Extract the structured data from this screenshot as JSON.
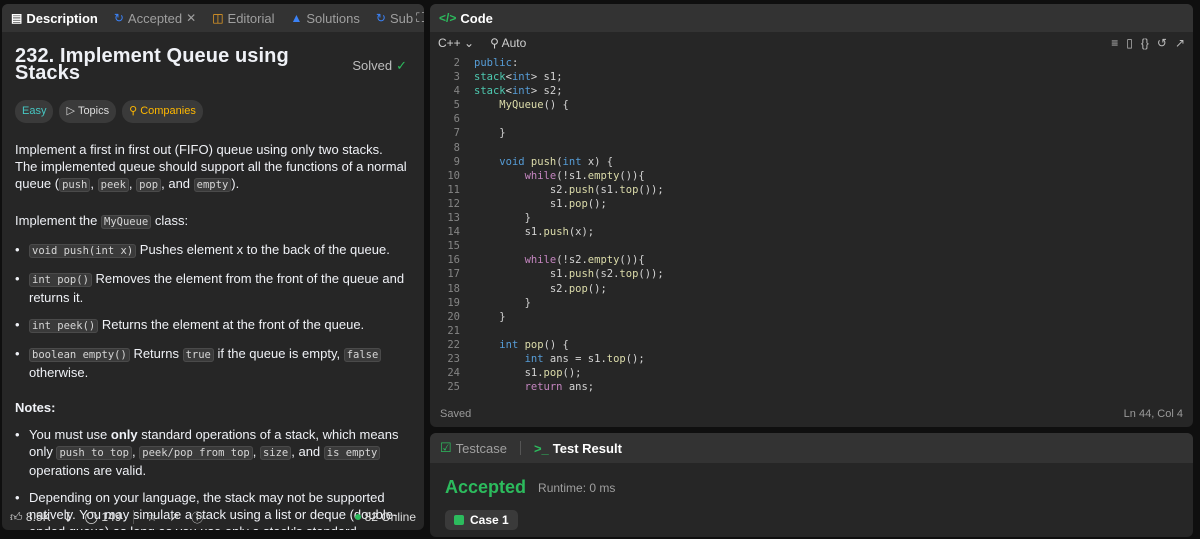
{
  "left_tabs": [
    {
      "label": "Description",
      "icon": "description-icon",
      "active": true
    },
    {
      "label": "Accepted",
      "icon": "history-icon",
      "active": false
    },
    {
      "label": "Editorial",
      "icon": "book-icon",
      "active": false
    },
    {
      "label": "Solutions",
      "icon": "flask-icon",
      "active": false
    },
    {
      "label": "Sub",
      "icon": "submissions-icon",
      "active": false
    }
  ],
  "problem": {
    "title": "232. Implement Queue using Stacks",
    "status": "Solved",
    "difficulty": "Easy",
    "topics_label": "Topics",
    "companies_label": "Companies",
    "intro_1": "Implement a first in first out (FIFO) queue using only two stacks. The implemented queue should support all the functions of a normal queue (",
    "intro_codes": [
      "push",
      "peek",
      "pop",
      "empty"
    ],
    "intro_end": ").",
    "implement_pre": "Implement the ",
    "implement_code": "MyQueue",
    "implement_post": " class:",
    "methods": [
      {
        "code": "void push(int x)",
        "text": " Pushes element x to the back of the queue."
      },
      {
        "code": "int pop()",
        "text": " Removes the element from the front of the queue and returns it."
      },
      {
        "code": "int peek()",
        "text": " Returns the element at the front of the queue."
      },
      {
        "code": "boolean empty()",
        "text_pre": " Returns ",
        "code2": "true",
        "text_mid": " if the queue is empty, ",
        "code3": "false",
        "text_post": " otherwise."
      }
    ],
    "notes_title": "Notes:",
    "note1_pre": "You must use ",
    "note1_bold": "only",
    "note1_post": " standard operations of a stack, which means only ",
    "note1_codes": [
      "push to top",
      "peek/pop from top",
      "size",
      "is empty"
    ],
    "note1_end": " operations are valid.",
    "note2": "Depending on your language, the stack may not be supported natively. You may simulate a stack using a list or deque (double-ended queue) as long as you use only a stack's standard operations."
  },
  "footer": {
    "likes": "8.5K",
    "comments": "149",
    "online": "82 Online"
  },
  "code_panel": {
    "title": "Code",
    "language": "C++",
    "mode": "Auto",
    "saved": "Saved",
    "cursor": "Ln 44, Col 4",
    "lines": [
      {
        "n": "2",
        "text": "public:"
      },
      {
        "n": "3",
        "text": "stack<int> s1;"
      },
      {
        "n": "4",
        "text": "stack<int> s2;"
      },
      {
        "n": "5",
        "text": "    MyQueue() {"
      },
      {
        "n": "6",
        "text": ""
      },
      {
        "n": "7",
        "text": "    }"
      },
      {
        "n": "8",
        "text": ""
      },
      {
        "n": "9",
        "text": "    void push(int x) {"
      },
      {
        "n": "10",
        "text": "        while(!s1.empty()){"
      },
      {
        "n": "11",
        "text": "            s2.push(s1.top());"
      },
      {
        "n": "12",
        "text": "            s1.pop();"
      },
      {
        "n": "13",
        "text": "        }"
      },
      {
        "n": "14",
        "text": "        s1.push(x);"
      },
      {
        "n": "15",
        "text": ""
      },
      {
        "n": "16",
        "text": "        while(!s2.empty()){"
      },
      {
        "n": "17",
        "text": "            s1.push(s2.top());"
      },
      {
        "n": "18",
        "text": "            s2.pop();"
      },
      {
        "n": "19",
        "text": "        }"
      },
      {
        "n": "20",
        "text": "    }"
      },
      {
        "n": "21",
        "text": ""
      },
      {
        "n": "22",
        "text": "    int pop() {"
      },
      {
        "n": "23",
        "text": "        int ans = s1.top();"
      },
      {
        "n": "24",
        "text": "        s1.pop();"
      },
      {
        "n": "25",
        "text": "        return ans;"
      }
    ]
  },
  "result_panel": {
    "testcase_label": "Testcase",
    "result_label": "Test Result",
    "verdict": "Accepted",
    "runtime": "Runtime: 0 ms",
    "case_label": "Case 1"
  },
  "colors": {
    "accent_green": "#2cbb5d",
    "easy": "#46c6c2",
    "companies": "#ffb800"
  }
}
